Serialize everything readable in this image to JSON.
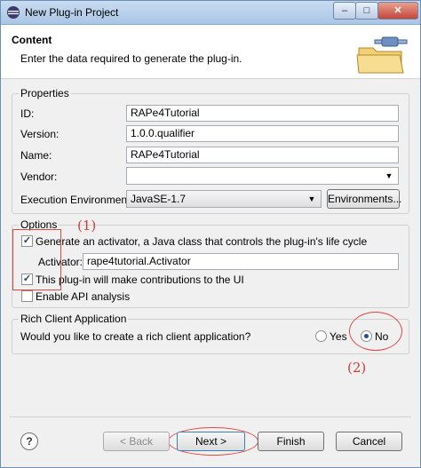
{
  "window": {
    "title": "New Plug-in Project",
    "minimize_label": "–",
    "maximize_label": "□",
    "close_label": "✕"
  },
  "header": {
    "title": "Content",
    "description": "Enter the data required to generate the plug-in."
  },
  "properties": {
    "group_label": "Properties",
    "id_label": "ID:",
    "id_value": "RAPe4Tutorial",
    "version_label": "Version:",
    "version_value": "1.0.0.qualifier",
    "name_label": "Name:",
    "name_value": "RAPe4Tutorial",
    "vendor_label": "Vendor:",
    "vendor_value": "",
    "exec_env_label": "Execution Environment:",
    "exec_env_value": "JavaSE-1.7",
    "environments_button": "Environments..."
  },
  "options": {
    "group_label": "Options",
    "generate_activator_label": "Generate an activator, a Java class that controls the plug-in's life cycle",
    "generate_activator_checked": true,
    "activator_label": "Activator:",
    "activator_value": "rape4tutorial.Activator",
    "ui_contrib_label": "This plug-in will make contributions to the UI",
    "ui_contrib_checked": true,
    "api_analysis_label": "Enable API analysis",
    "api_analysis_checked": false
  },
  "rca": {
    "group_label": "Rich Client Application",
    "question": "Would you like to create a rich client application?",
    "yes_label": "Yes",
    "no_label": "No",
    "selected": "No"
  },
  "annotations": {
    "step1": "(1)",
    "step2": "(2)"
  },
  "footer": {
    "help_label": "?",
    "back_label": "< Back",
    "next_label": "Next >",
    "finish_label": "Finish",
    "cancel_label": "Cancel"
  },
  "colors": {
    "annotation": "#e04848",
    "title_bar": "#b9d1ea"
  }
}
